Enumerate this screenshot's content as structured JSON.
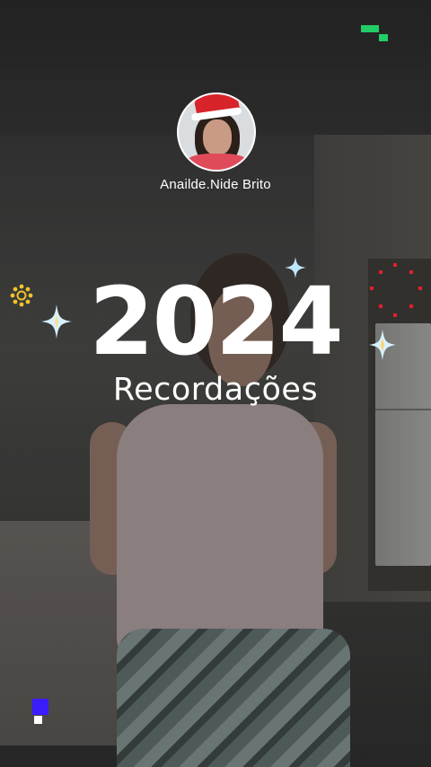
{
  "profile": {
    "username": "Anailde.Nide Brito"
  },
  "headline": {
    "year": "2024",
    "subtitle": "Recordações"
  },
  "decorations": {
    "sparkle_color": "#bfe6ff",
    "sun_color": "#f2c22a",
    "dots_color": "#e0202a",
    "corner_top_color": "#22cc66",
    "corner_bottom_color": "#3a1cff"
  }
}
